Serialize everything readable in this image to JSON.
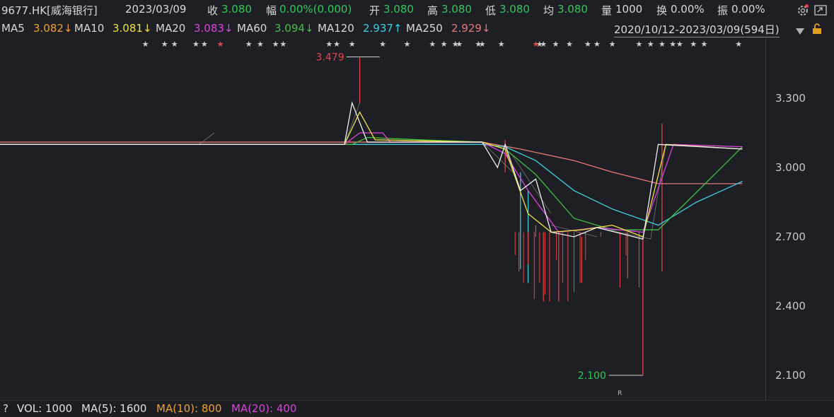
{
  "header": {
    "stock": "9677.HK[威海银行]",
    "date": "2023/03/09",
    "close_label": "收",
    "close": "3.080",
    "change_label": "幅",
    "change": "0.00%(0.000)",
    "open_label": "开",
    "open": "3.080",
    "high_label": "高",
    "high": "3.080",
    "low_label": "低",
    "low": "3.080",
    "avg_label": "均",
    "avg": "3.080",
    "vol_label": "量",
    "vol": "1000",
    "turnover_label": "换",
    "turnover": "0.00%",
    "amp_label": "振",
    "amp": "0.00%"
  },
  "ma": {
    "ma5_label": "MA5",
    "ma5": "3.082↓",
    "ma10_label": "MA10",
    "ma10": "3.081↓",
    "ma20_label": "MA20",
    "ma20": "3.083↓",
    "ma60_label": "MA60",
    "ma60": "3.094↓",
    "ma120_label": "MA120",
    "ma120": "2.937↑",
    "ma250_label": "MA250",
    "ma250": "2.929↓",
    "range": "2020/10/12-2023/03/09(594日)"
  },
  "volume": {
    "help": "?",
    "text": "VOL: 1000",
    "ma5": "MA(5): 1600",
    "ma10": "MA(10): 800",
    "ma20": "MA(20): 400"
  },
  "colors": {
    "up": "#e84545",
    "down": "#2ec95a",
    "ma5": "#f0f0f0",
    "ma10": "#f0e040",
    "ma20": "#e040e0",
    "ma60": "#40c040",
    "ma120": "#40d0e0",
    "ma250": "#e87878"
  },
  "icons": [
    "gear-icon",
    "window-icon",
    "dropdown-icon",
    "lock-icon"
  ],
  "chart_data": {
    "type": "candlestick",
    "ylim": [
      2.0,
      3.5
    ],
    "yticks": [
      3.3,
      3.0,
      2.7,
      2.4,
      2.1
    ],
    "ytick_labels": [
      "3.300",
      "3.000",
      "2.700",
      "2.400",
      "2.100"
    ],
    "annotations": [
      {
        "text": "3.479",
        "x_frac_data": 0.459,
        "y": 3.479
      },
      {
        "text": "2.100",
        "x_frac_data": 0.84,
        "y": 2.1
      }
    ],
    "r_marker": "R",
    "segments": [
      {
        "t": [
          0,
          0.06
        ],
        "p": [
          3.1,
          3.1
        ]
      },
      {
        "t": [
          0.06,
          0.26
        ],
        "p": [
          3.1,
          3.1
        ]
      },
      {
        "t": [
          0.26,
          0.28
        ],
        "p": [
          3.1,
          3.15
        ]
      },
      {
        "t": [
          0.28,
          0.45
        ],
        "p": [
          3.1,
          3.1
        ]
      },
      {
        "t": [
          0.45,
          0.47
        ],
        "p": [
          3.1,
          3.28
        ]
      },
      {
        "t": [
          0.47,
          0.63
        ],
        "p": [
          3.11,
          3.11
        ]
      },
      {
        "t": [
          0.63,
          0.67
        ],
        "p": [
          3.11,
          2.98
        ]
      },
      {
        "t": [
          0.67,
          0.72
        ],
        "p": [
          3.05,
          2.8
        ]
      },
      {
        "t": [
          0.72,
          0.78
        ],
        "p": [
          2.75,
          2.7
        ]
      },
      {
        "t": [
          0.78,
          0.85
        ],
        "p": [
          2.74,
          2.69
        ]
      },
      {
        "t": [
          0.85,
          0.87
        ],
        "p": [
          2.69,
          3.1
        ]
      },
      {
        "t": [
          0.87,
          0.97
        ],
        "p": [
          3.1,
          3.08
        ]
      }
    ],
    "ma_lines": {
      "ma5": [
        [
          0,
          3.1
        ],
        [
          0.45,
          3.1
        ],
        [
          0.46,
          3.28
        ],
        [
          0.48,
          3.11
        ],
        [
          0.63,
          3.11
        ],
        [
          0.65,
          3.0
        ],
        [
          0.66,
          3.1
        ],
        [
          0.68,
          2.9
        ],
        [
          0.7,
          2.95
        ],
        [
          0.72,
          2.72
        ],
        [
          0.75,
          2.7
        ],
        [
          0.78,
          2.74
        ],
        [
          0.84,
          2.69
        ],
        [
          0.86,
          3.1
        ],
        [
          0.97,
          3.08
        ]
      ],
      "ma10": [
        [
          0,
          3.1
        ],
        [
          0.45,
          3.1
        ],
        [
          0.47,
          3.24
        ],
        [
          0.49,
          3.12
        ],
        [
          0.63,
          3.11
        ],
        [
          0.66,
          3.08
        ],
        [
          0.69,
          2.8
        ],
        [
          0.72,
          2.72
        ],
        [
          0.76,
          2.73
        ],
        [
          0.8,
          2.75
        ],
        [
          0.84,
          2.7
        ],
        [
          0.87,
          3.1
        ],
        [
          0.97,
          3.08
        ]
      ],
      "ma20": [
        [
          0,
          3.1
        ],
        [
          0.45,
          3.1
        ],
        [
          0.47,
          3.15
        ],
        [
          0.5,
          3.15
        ],
        [
          0.51,
          3.11
        ],
        [
          0.63,
          3.11
        ],
        [
          0.66,
          3.06
        ],
        [
          0.69,
          2.9
        ],
        [
          0.73,
          2.72
        ],
        [
          0.78,
          2.74
        ],
        [
          0.84,
          2.72
        ],
        [
          0.88,
          3.1
        ],
        [
          0.97,
          3.09
        ]
      ],
      "ma60": [
        [
          0,
          3.1
        ],
        [
          0.46,
          3.1
        ],
        [
          0.48,
          3.13
        ],
        [
          0.55,
          3.12
        ],
        [
          0.63,
          3.11
        ],
        [
          0.66,
          3.08
        ],
        [
          0.7,
          2.97
        ],
        [
          0.75,
          2.78
        ],
        [
          0.8,
          2.73
        ],
        [
          0.86,
          2.73
        ],
        [
          0.9,
          2.86
        ],
        [
          0.97,
          3.09
        ]
      ],
      "ma120": [
        [
          0,
          3.1
        ],
        [
          0.63,
          3.1
        ],
        [
          0.66,
          3.09
        ],
        [
          0.7,
          3.03
        ],
        [
          0.75,
          2.9
        ],
        [
          0.8,
          2.82
        ],
        [
          0.86,
          2.75
        ],
        [
          0.91,
          2.85
        ],
        [
          0.97,
          2.94
        ]
      ],
      "ma250": [
        [
          0,
          3.11
        ],
        [
          0.63,
          3.11
        ],
        [
          0.68,
          3.08
        ],
        [
          0.75,
          3.03
        ],
        [
          0.8,
          2.98
        ],
        [
          0.86,
          2.93
        ],
        [
          0.9,
          2.93
        ],
        [
          0.97,
          2.93
        ]
      ]
    },
    "wicks": [
      [
        0.47,
        3.28,
        3.479
      ],
      [
        0.66,
        2.98,
        3.12
      ],
      [
        0.68,
        2.56,
        2.98
      ],
      [
        0.69,
        2.5,
        2.9
      ],
      [
        0.7,
        2.7,
        2.75
      ],
      [
        0.71,
        2.42,
        2.72
      ],
      [
        0.73,
        2.42,
        2.72
      ],
      [
        0.76,
        2.5,
        2.7
      ],
      [
        0.82,
        2.52,
        2.72
      ],
      [
        0.84,
        2.1,
        2.69
      ],
      [
        0.865,
        2.55,
        3.19
      ]
    ]
  }
}
